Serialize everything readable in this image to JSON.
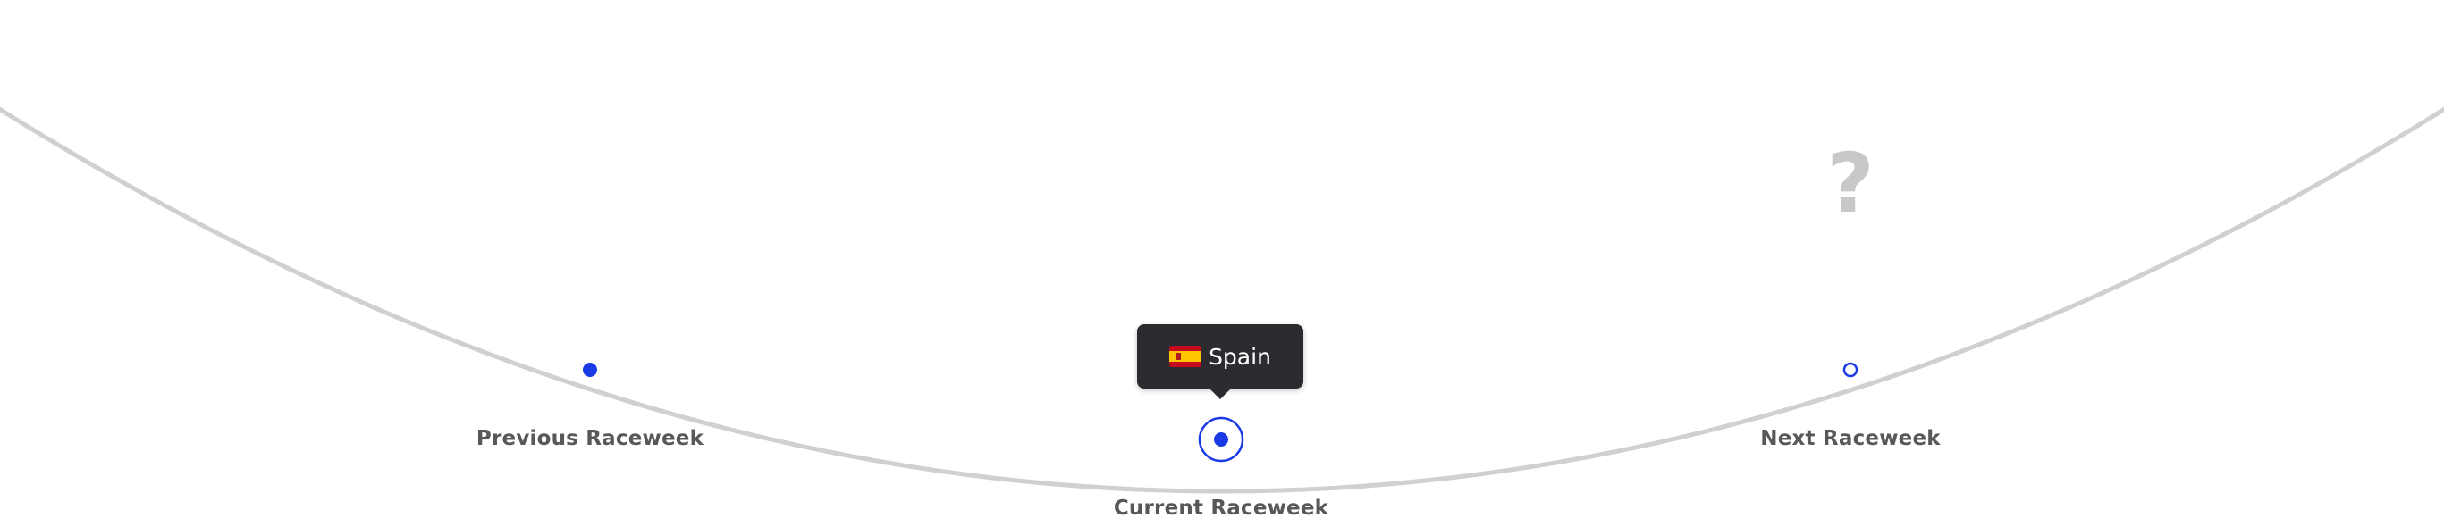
{
  "timeline": {
    "previous_label": "Previous Raceweek",
    "current_label": "Current Raceweek",
    "next_label": "Next Raceweek",
    "current_country": "Spain",
    "next_placeholder": "?"
  },
  "colors": {
    "accent": "#1a3ae6",
    "arc": "#d0d0d0",
    "tooltip_bg": "#2b2b30",
    "label_text": "#585858",
    "placeholder": "#c8c8c8"
  },
  "icons": {
    "current_flag": "spain-flag-icon",
    "unknown_next": "question-mark-icon"
  }
}
